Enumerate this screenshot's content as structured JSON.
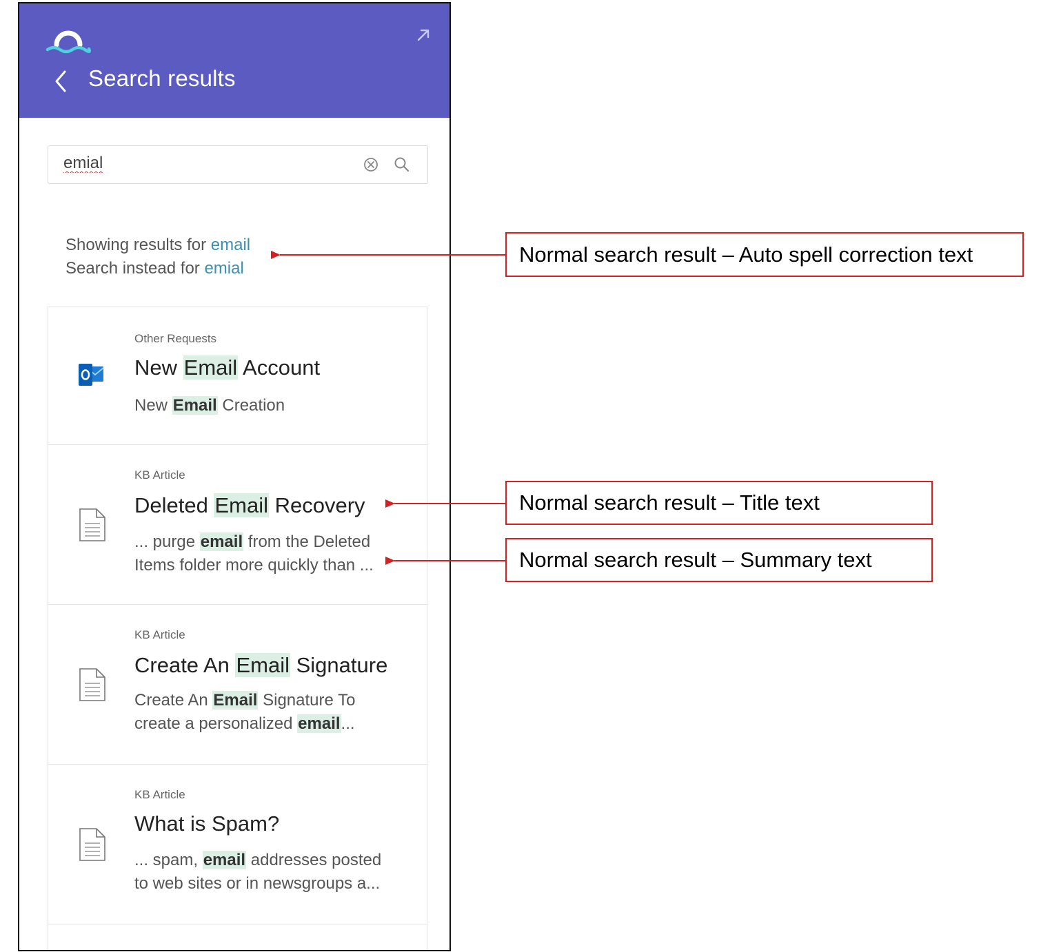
{
  "header": {
    "title": "Search results"
  },
  "search": {
    "value": "emial"
  },
  "spell_correction": {
    "showing_prefix": "Showing results for",
    "corrected_term": "email",
    "instead_prefix": "Search instead for",
    "original_term": "emial"
  },
  "results": [
    {
      "category": "Other Requests",
      "icon": "outlook-icon",
      "title_pre": "New ",
      "title_hl": "Email",
      "title_post": " Account",
      "summary_lines": [
        {
          "pre": "New ",
          "hl": "Email",
          "post": " Creation"
        }
      ]
    },
    {
      "category": "KB Article",
      "icon": "document-icon",
      "title_pre": "Deleted ",
      "title_hl": "Email",
      "title_post": " Recovery",
      "summary_lines": [
        {
          "pre": "... purge ",
          "hl": "email",
          "post": " from the Deleted"
        },
        {
          "pre": "Items folder more quickly than ...",
          "hl": "",
          "post": ""
        }
      ]
    },
    {
      "category": "KB Article",
      "icon": "document-icon",
      "title_pre": "Create An ",
      "title_hl": "Email",
      "title_post": " Signature",
      "summary_lines": [
        {
          "pre": "Create An ",
          "hl": "Email",
          "post": " Signature To"
        },
        {
          "pre": "create a personalized ",
          "hl": "email",
          "post": "..."
        }
      ]
    },
    {
      "category": "KB Article",
      "icon": "document-icon",
      "title_pre": "What is Spam?",
      "title_hl": "",
      "title_post": "",
      "summary_lines": [
        {
          "pre": "... spam, ",
          "hl": "email",
          "post": " addresses posted"
        },
        {
          "pre": "to web sites or in newsgroups a...",
          "hl": "",
          "post": ""
        }
      ]
    }
  ],
  "annotations": {
    "spell": "Normal search result – Auto spell correction text",
    "title": "Normal search result – Title text",
    "summary": "Normal search result – Summary text"
  },
  "colors": {
    "header_bg": "#5b5bc2",
    "link": "#3c8fb0",
    "highlight": "#dcefe4",
    "annotation_red": "#d42020"
  }
}
